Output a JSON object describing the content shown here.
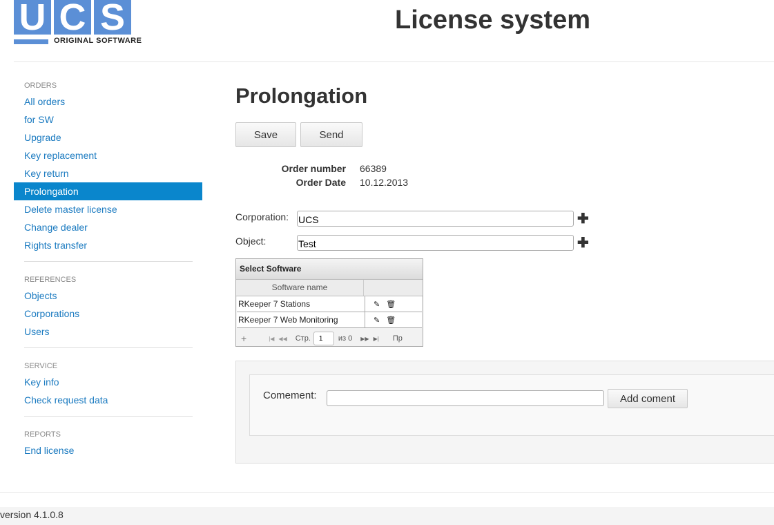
{
  "header": {
    "logo_letters": [
      "U",
      "C",
      "S"
    ],
    "logo_subtitle": "ORIGINAL SOFTWARE",
    "app_title": "License system"
  },
  "sidebar": {
    "sections": [
      {
        "title": "ORDERS",
        "items": [
          "All orders",
          "for SW",
          "Upgrade",
          "Key replacement",
          "Key return",
          "Prolongation",
          "Delete master license",
          "Change dealer",
          "Rights transfer"
        ]
      },
      {
        "title": "REFERENCES",
        "items": [
          "Objects",
          "Corporations",
          "Users"
        ]
      },
      {
        "title": "SERVICE",
        "items": [
          "Key info",
          "Check request data"
        ]
      },
      {
        "title": "REPORTS",
        "items": [
          "End license"
        ]
      }
    ],
    "active_item": "Prolongation",
    "active_color": "#0a86cc"
  },
  "main": {
    "title": "Prolongation",
    "buttons": {
      "save": "Save",
      "send": "Send"
    },
    "order_number_label": "Order number",
    "order_number": "66389",
    "order_date_label": "Order Date",
    "order_date": "10.12.2013",
    "corporation_label": "Corporation:",
    "corporation_value": "UCS",
    "object_label": "Object:",
    "object_value": "Test",
    "add_glyph": "✚"
  },
  "grid": {
    "caption": "Select Software",
    "column_header": "Software name",
    "rows": [
      {
        "name": "RKeeper 7 Stations"
      },
      {
        "name": "RKeeper 7 Web Monitoring"
      }
    ],
    "edit_icon": "✎",
    "delete_icon": "🗑",
    "pager": {
      "page_label": "Стр.",
      "page_value": "1",
      "of_label": "из 0",
      "trailing": "Пр"
    }
  },
  "comment": {
    "label": "Comement:",
    "value": "",
    "button": "Add coment"
  },
  "footer": {
    "version": "version 4.1.0.8"
  }
}
